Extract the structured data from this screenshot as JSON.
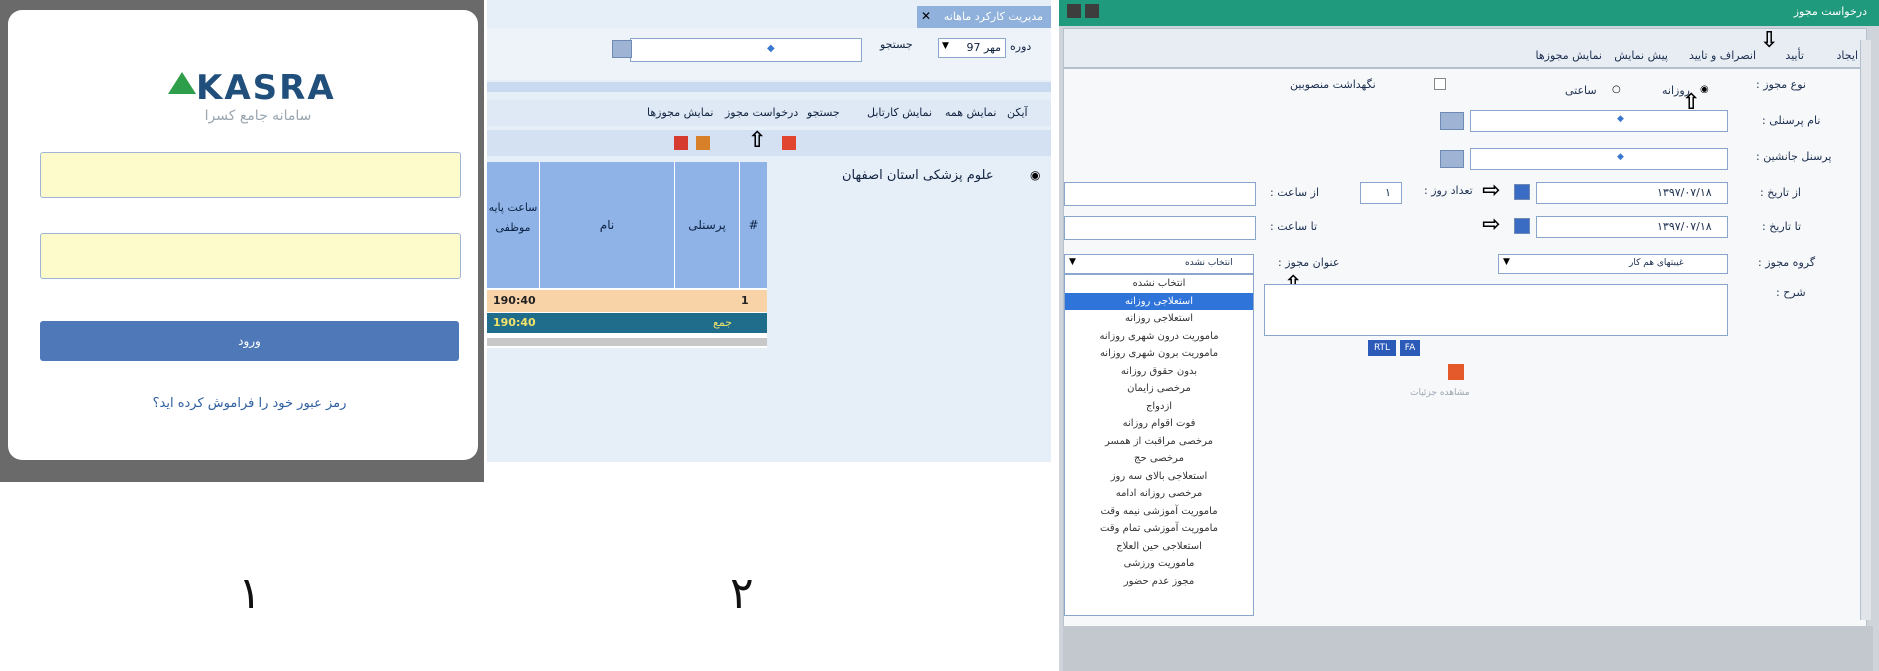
{
  "panel1": {
    "logo_text": "KASRA",
    "logo_subtitle": "سامانه جامع کسرا",
    "login_button": "ورود",
    "forgot_link": "رمز عبور خود را فراموش کرده اید؟",
    "caption": "۱"
  },
  "panel2": {
    "tab_title": "مدیریت کارکرد ماهانه",
    "period_label": "دوره",
    "period_value": "مهر 97",
    "search_label": "جستجو",
    "toolbar_items": [
      "آیکن",
      "نمایش همه",
      "نمایش کارتابل",
      "جستجو",
      "درخواست مجوز",
      "نمایش مجوزها"
    ],
    "tree_root": "علوم پزشکی استان اصفهان",
    "grid_headers": [
      "#",
      "پرسنلی",
      "نام",
      "ساعت پایه موظفی"
    ],
    "rows": [
      {
        "index": "1",
        "hours": "190:40"
      },
      {
        "index": "جمع",
        "hours": "190:40"
      }
    ],
    "caption": "۲"
  },
  "panel3": {
    "window_title": "درخواست مجوز",
    "toolbar_items": [
      "ایجاد",
      "تأیید",
      "انصراف و تایید",
      "پیش نمایش",
      "نمایش مجوزها"
    ],
    "labels": {
      "type": "نوع مجوز :",
      "daily": "روزانه",
      "hourly": "ساعتی",
      "keep_selected": "نگهداشت منصوبین",
      "personnel_name": "نام پرسنلی :",
      "substitute": "پرسنل جانشین :",
      "from_date": "از تاریخ :",
      "to_date": "تا تاریخ :",
      "days_count": "تعداد روز :",
      "from_hour": "از ساعت :",
      "to_hour": "تا ساعت :",
      "permit_group": "گروه مجوز :",
      "permit_title": "عنوان مجوز :",
      "description": "شرح :"
    },
    "days_value": "۱",
    "from_date_value": "۱۳۹۷/۰۷/۱۸",
    "to_date_value": "۱۳۹۷/۰۷/۱۸",
    "permit_group_value": "غیبتهای هم کار",
    "permit_title_value": "انتخاب نشده",
    "rtl_button": "RTL",
    "fa_button": "FA",
    "footer_text": "مشاهده جزئیات",
    "dropdown_options": [
      "انتخاب نشده",
      "استعلاجی روزانه",
      "استعلاجی روزانه",
      "ماموریت درون شهری روزانه",
      "ماموریت برون شهری روزانه",
      "بدون حقوق روزانه",
      "مرخصی زایمان",
      "ازدواج",
      "فوت اقوام روزانه",
      "مرخصی مراقبت از همسر",
      "مرخصی حج",
      "استعلاجی بالای سه روز",
      "مرخصی روزانه ادامه",
      "ماموریت آموزشی نیمه وقت",
      "ماموریت آموزشی تمام وقت",
      "استعلاجی حین العلاج",
      "ماموریت ورزشی",
      "مجوز عدم حضور"
    ],
    "selected_option_index": 1
  },
  "colors": {
    "login_button": "#4f78b9",
    "field_yellow": "#fdfbcc",
    "title_green": "#1f9a7c",
    "grid_header": "#8fb3e6",
    "selected_row": "#f9d3a8",
    "total_row": "#1f6d8a"
  }
}
